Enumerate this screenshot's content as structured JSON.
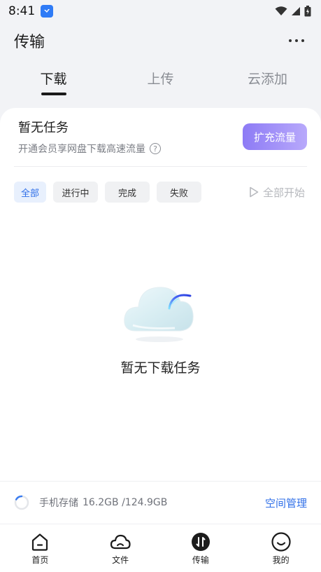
{
  "status_bar": {
    "time": "8:41"
  },
  "header": {
    "title": "传输",
    "more_icon": "more-horizontal-icon"
  },
  "tabs": [
    {
      "label": "下载",
      "active": true
    },
    {
      "label": "上传",
      "active": false
    },
    {
      "label": "云添加",
      "active": false
    }
  ],
  "promo": {
    "title": "暂无任务",
    "subtitle": "开通会员享网盘下载高速流量",
    "help_icon": "?",
    "button_label": "扩充流量",
    "button_color": "#9d8df7"
  },
  "filters": {
    "chips": [
      {
        "label": "全部",
        "active": true
      },
      {
        "label": "进行中",
        "active": false
      },
      {
        "label": "完成",
        "active": false
      },
      {
        "label": "失败",
        "active": false
      }
    ],
    "start_all_label": "全部开始"
  },
  "empty_state": {
    "text": "暂无下载任务"
  },
  "storage": {
    "label": "手机存储",
    "value": "16.2GB /124.9GB",
    "action": "空间管理",
    "accent": "#2f6fe8"
  },
  "bottom_nav": [
    {
      "label": "首页",
      "icon": "home-icon"
    },
    {
      "label": "文件",
      "icon": "cloud-icon"
    },
    {
      "label": "传输",
      "icon": "transfer-icon",
      "active": true
    },
    {
      "label": "我的",
      "icon": "smile-icon"
    }
  ]
}
